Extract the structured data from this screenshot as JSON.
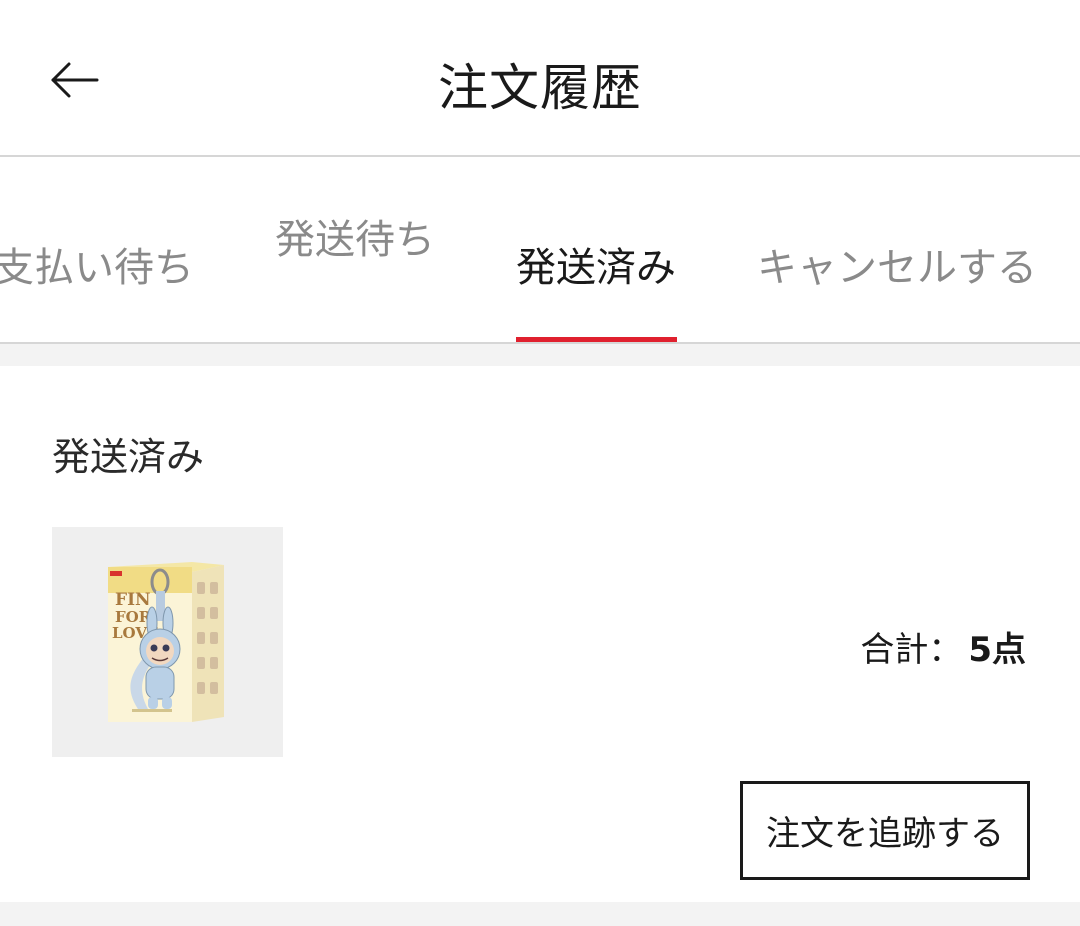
{
  "header": {
    "title": "注文履歴",
    "back_icon": "arrow-left-icon"
  },
  "tabs": [
    {
      "label": "支払い待ち",
      "active": false
    },
    {
      "label": "発送待ち",
      "active": false
    },
    {
      "label": "発送済み",
      "active": true
    },
    {
      "label": "キャンセルする",
      "active": false
    }
  ],
  "colors": {
    "accent": "#e0202e",
    "inactive_tab": "#8a8a8a",
    "divider": "#d6d6d6",
    "background_gray": "#f3f3f3"
  },
  "order": {
    "status": "発送済み",
    "product_image": {
      "box_text_line1": "FIN",
      "box_text_line2": "FOR",
      "box_text_line3": "LOVE"
    },
    "total_label": "合計：",
    "total_count": "5点",
    "track_button": "注文を追跡する"
  }
}
